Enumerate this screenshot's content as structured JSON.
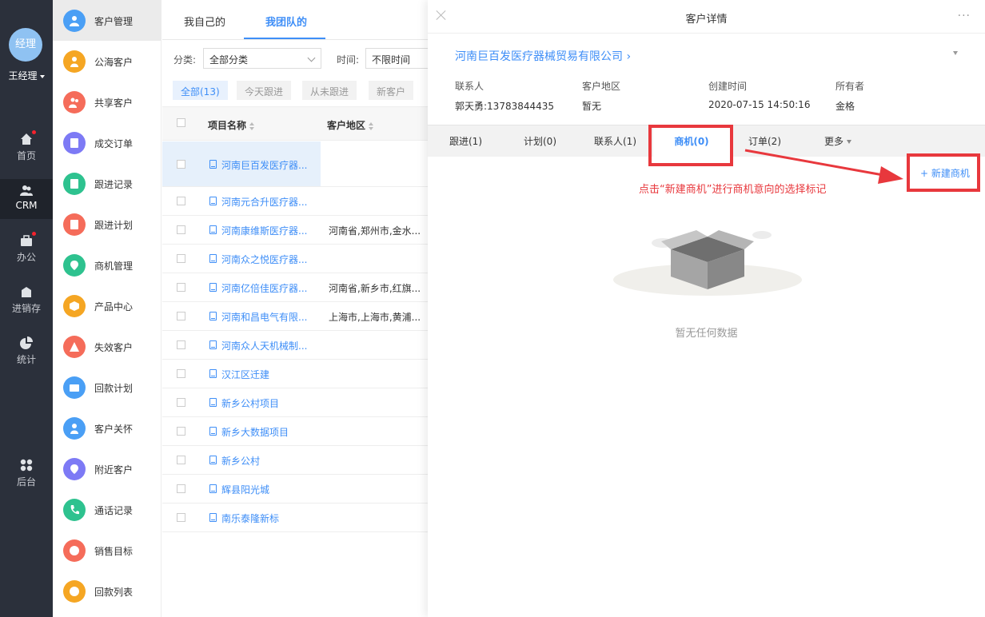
{
  "nav": {
    "avatar": "经理",
    "user": "王经理",
    "items": [
      {
        "label": "首页",
        "icon": "home-icon"
      },
      {
        "label": "CRM",
        "icon": "crm-icon"
      },
      {
        "label": "办公",
        "icon": "briefcase-icon"
      },
      {
        "label": "进销存",
        "icon": "warehouse-icon"
      },
      {
        "label": "统计",
        "icon": "pie-chart-icon"
      },
      {
        "label": "后台",
        "icon": "grid-icon"
      }
    ]
  },
  "menu": {
    "items": [
      {
        "label": "客户管理",
        "color": "#4a9ff5"
      },
      {
        "label": "公海客户",
        "color": "#f5a623"
      },
      {
        "label": "共享客户",
        "color": "#f56c5a"
      },
      {
        "label": "成交订单",
        "color": "#7d7af5"
      },
      {
        "label": "跟进记录",
        "color": "#2ec28f"
      },
      {
        "label": "跟进计划",
        "color": "#f56c5a"
      },
      {
        "label": "商机管理",
        "color": "#2ec28f"
      },
      {
        "label": "产品中心",
        "color": "#f5a623"
      },
      {
        "label": "失效客户",
        "color": "#f56c5a"
      },
      {
        "label": "回款计划",
        "color": "#4a9ff5"
      },
      {
        "label": "客户关怀",
        "color": "#4a9ff5"
      },
      {
        "label": "附近客户",
        "color": "#7d7af5"
      },
      {
        "label": "通话记录",
        "color": "#2ec28f"
      },
      {
        "label": "销售目标",
        "color": "#f56c5a"
      },
      {
        "label": "回款列表",
        "color": "#f5a623"
      }
    ]
  },
  "list": {
    "tabs": [
      "我自己的",
      "我团队的"
    ],
    "filter_category_label": "分类:",
    "filter_category_value": "全部分类",
    "filter_time_label": "时间:",
    "filter_time_value": "不限时间",
    "chips": [
      "全部(13)",
      "今天跟进",
      "从未跟进",
      "新客户"
    ],
    "columns": [
      "项目名称",
      "客户地区"
    ],
    "rows": [
      {
        "name": "河南巨百发医疗器...",
        "region": ""
      },
      {
        "name": "河南元合升医疗器...",
        "region": ""
      },
      {
        "name": "河南康维斯医疗器...",
        "region": "河南省,郑州市,金水..."
      },
      {
        "name": "河南众之悦医疗器...",
        "region": ""
      },
      {
        "name": "河南亿倍佳医疗器...",
        "region": "河南省,新乡市,红旗..."
      },
      {
        "name": "河南和昌电气有限...",
        "region": "上海市,上海市,黄浦..."
      },
      {
        "name": "河南众人天机械制...",
        "region": ""
      },
      {
        "name": "汉江区迁建",
        "region": ""
      },
      {
        "name": "新乡公村项目",
        "region": ""
      },
      {
        "name": "新乡大数据项目",
        "region": ""
      },
      {
        "name": "新乡公村",
        "region": ""
      },
      {
        "name": "辉县阳光城",
        "region": ""
      },
      {
        "name": "南乐泰隆新标",
        "region": ""
      }
    ]
  },
  "detail": {
    "title": "客户详情",
    "more": "···",
    "company": "河南巨百发医疗器械贸易有限公司 ›",
    "fields": [
      {
        "key": "联系人",
        "value": "郭天勇:13783844435"
      },
      {
        "key": "客户地区",
        "value": "暂无"
      },
      {
        "key": "创建时间",
        "value": "2020-07-15 14:50:16"
      },
      {
        "key": "所有者",
        "value": "金格"
      }
    ],
    "tabs": [
      "跟进(1)",
      "计划(0)",
      "联系人(1)",
      "商机(0)",
      "订单(2)",
      "更多"
    ],
    "new_button": "+ 新建商机",
    "annotation": "点击“新建商机”进行商机意向的选择标记",
    "empty_text": "暂无任何数据"
  },
  "colors": {
    "accent": "#3e8ef7",
    "annotation": "#e8383d",
    "nav_bg": "#2b303b"
  }
}
